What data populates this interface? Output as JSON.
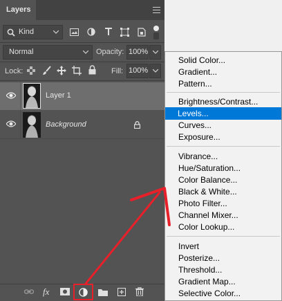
{
  "panel": {
    "tab_label": "Layers",
    "filter_kind": "Kind",
    "blend_mode": "Normal",
    "opacity_label": "Opacity:",
    "opacity_value": "100%",
    "lock_label": "Lock:",
    "fill_label": "Fill:",
    "fill_value": "100%",
    "layers": [
      {
        "name": "Layer 1",
        "selected": true,
        "italic": false
      },
      {
        "name": "Background",
        "selected": false,
        "italic": true,
        "locked": true
      }
    ]
  },
  "menu": {
    "groups": [
      [
        "Solid Color...",
        "Gradient...",
        "Pattern..."
      ],
      [
        "Brightness/Contrast...",
        "Levels...",
        "Curves...",
        "Exposure..."
      ],
      [
        "Vibrance...",
        "Hue/Saturation...",
        "Color Balance...",
        "Black & White...",
        "Photo Filter...",
        "Channel Mixer...",
        "Color Lookup..."
      ],
      [
        "Invert",
        "Posterize...",
        "Threshold...",
        "Gradient Map...",
        "Selective Color..."
      ]
    ],
    "highlighted": "Levels..."
  },
  "colors": {
    "panel_bg": "#535353",
    "selected_layer": "#6e6e6e",
    "menu_highlight": "#0078d7",
    "annotation": "#e8202a"
  }
}
